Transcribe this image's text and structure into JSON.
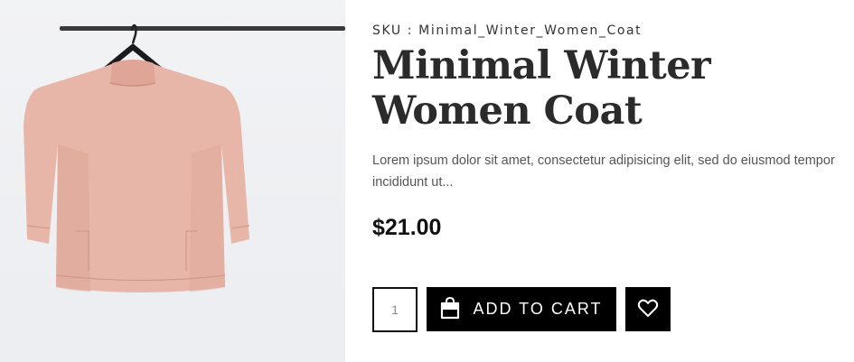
{
  "product": {
    "image_alt": "pink sweater on hanger",
    "sku": "SKU : Minimal_Winter_Women_Coat",
    "title": "Minimal Winter Women Coat",
    "description": "Lorem ipsum dolor sit amet, consectetur adipisicing elit, sed do eiusmod tempor incididunt ut...",
    "price": "$21.00"
  },
  "cart": {
    "quantity": "1",
    "add_to_cart_label": "ADD TO CART",
    "cart_icon": "shopping-bag-icon",
    "wishlist_icon": "heart-icon"
  },
  "colors": {
    "button_bg": "#000000",
    "button_text": "#ffffff",
    "garment": "#e7b5a8"
  }
}
